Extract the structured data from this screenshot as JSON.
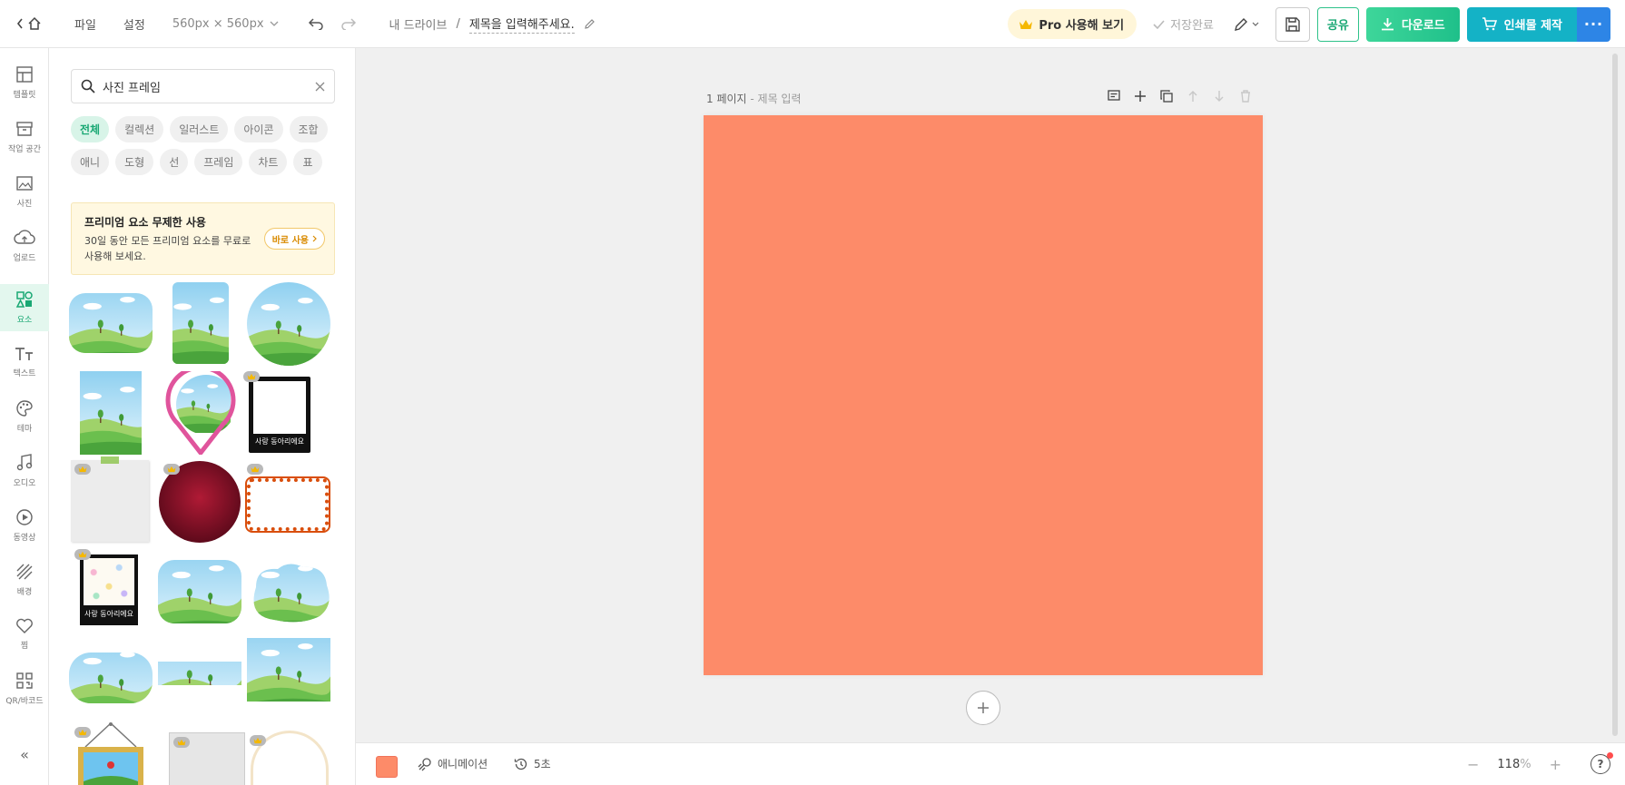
{
  "topbar": {
    "menus": [
      "파일",
      "설정"
    ],
    "canvas_size": "560px × 560px",
    "breadcrumb_root": "내 드라이브",
    "breadcrumb_sep": "/",
    "doc_title": "제목을 입력해주세요.",
    "pro_label": "Pro 사용해 보기",
    "save_status": "저장완료",
    "share_label": "공유",
    "download_label": "다운로드",
    "print_label": "인쇄물 제작",
    "more_label": "···"
  },
  "rail": {
    "items": [
      {
        "label": "템플릿",
        "icon": "template-icon"
      },
      {
        "label": "작업 공간",
        "icon": "workspace-icon"
      },
      {
        "label": "사진",
        "icon": "photo-icon"
      },
      {
        "label": "업로드",
        "icon": "upload-icon"
      },
      {
        "label": "요소",
        "icon": "elements-icon",
        "active": true
      },
      {
        "label": "텍스트",
        "icon": "text-icon"
      },
      {
        "label": "테마",
        "icon": "theme-icon"
      },
      {
        "label": "오디오",
        "icon": "audio-icon"
      },
      {
        "label": "동영상",
        "icon": "video-icon"
      },
      {
        "label": "배경",
        "icon": "background-icon"
      },
      {
        "label": "찜",
        "icon": "heart-icon"
      },
      {
        "label": "QR/바코드",
        "icon": "qr-icon"
      }
    ],
    "collapse": "«"
  },
  "panel": {
    "search_value": "사진 프레임",
    "chips": [
      "전체",
      "컬렉션",
      "일러스트",
      "아이콘",
      "조합",
      "애니",
      "도형",
      "선",
      "프레임",
      "차트",
      "표"
    ],
    "active_chip": "전체",
    "promo": {
      "title": "프리미엄 요소 무제한 사용",
      "desc": "30일 동안 모든 프리미엄 요소를 무료로 사용해 보세요.",
      "button": "바로 사용"
    },
    "polaroid_caption": "사랑 동아리에요"
  },
  "canvas": {
    "page_label": "1 페이지",
    "page_sub": " - 제목 입력",
    "page_color": "#fd8b69"
  },
  "bottombar": {
    "animation": "애니메이션",
    "duration": "5초",
    "zoom": "118",
    "zoom_unit": "%",
    "help": "?"
  }
}
